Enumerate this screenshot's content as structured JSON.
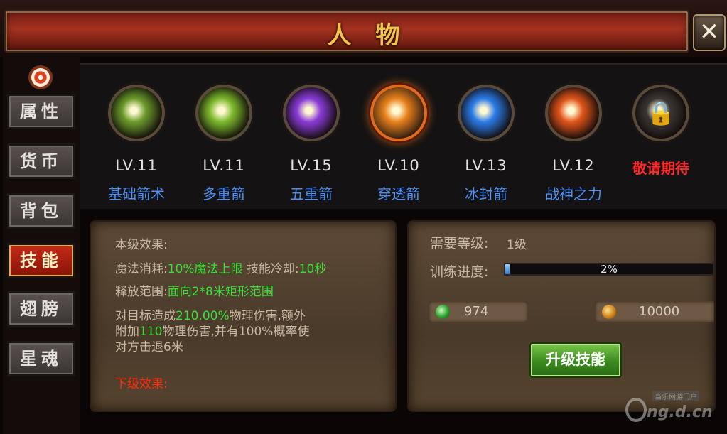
{
  "header": {
    "title": "人物",
    "close_label": "✕"
  },
  "tabs": [
    {
      "label": "属性",
      "active": false
    },
    {
      "label": "货币",
      "active": false
    },
    {
      "label": "背包",
      "active": false
    },
    {
      "label": "技能",
      "active": true
    },
    {
      "label": "翅膀",
      "active": false
    },
    {
      "label": "星魂",
      "active": false
    }
  ],
  "skills": [
    {
      "level": "LV.11",
      "name": "基础箭术",
      "color": "#6a9a2a"
    },
    {
      "level": "LV.11",
      "name": "多重箭",
      "color": "#7ab82a"
    },
    {
      "level": "LV.15",
      "name": "五重箭",
      "color": "#8a3ad8"
    },
    {
      "level": "LV.10",
      "name": "穿透箭",
      "color": "#e8801a",
      "selected": true
    },
    {
      "level": "LV.13",
      "name": "冰封箭",
      "color": "#2a7ae8"
    },
    {
      "level": "LV.12",
      "name": "战神之力",
      "color": "#e0541a"
    },
    {
      "level": "",
      "name": "",
      "coming_soon": "敬请期待",
      "color": "#3a3634"
    }
  ],
  "effect": {
    "current_title": "本级效果:",
    "mana_label": "魔法消耗:",
    "mana_value": "10%魔法上限",
    "cooldown_label": "技能冷却:",
    "cooldown_value": "10秒",
    "range_label": "释放范围:",
    "range_value": "面向2*8米矩形范围",
    "line1_a": "对目标造成",
    "line1_b": "210.00%",
    "line1_c": "物理伤害,额外",
    "line2_a": "附加",
    "line2_b": "110",
    "line2_c": "物理伤害,并有100%概率使",
    "line3": "对方击退6米",
    "next_title": "下级效果:"
  },
  "upgrade": {
    "req_label": "需要等级:",
    "req_value": "1级",
    "train_label": "训练进度:",
    "progress": 2,
    "progress_text": "2%",
    "gem_cost": "974",
    "gold_cost": "10000",
    "button_label": "升级技能"
  },
  "watermark": {
    "small": "当乐网游门户",
    "big": "ng.d.cn"
  }
}
